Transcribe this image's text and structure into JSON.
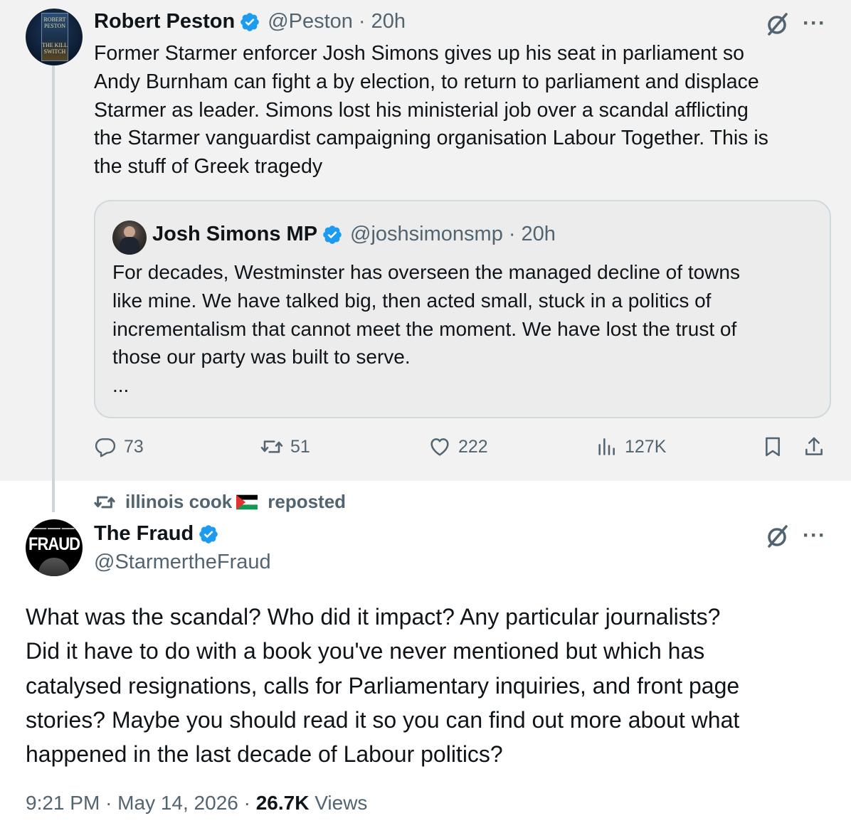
{
  "parent_tweet": {
    "author_name": "Robert Peston",
    "handle": "@Peston",
    "separator": "·",
    "time": "20h",
    "avatar_book_lines": [
      "ROBERT",
      "PESTON",
      "THE KILL",
      "SWITCH"
    ],
    "text_lines": [
      "Former Starmer enforcer Josh Simons gives up his seat in parliament so",
      "Andy Burnham can fight a by election, to return to parliament and displace",
      "Starmer as leader.  Simons lost his ministerial job over a scandal afflicting",
      "the Starmer vanguardist campaigning organisation Labour Together.  This is",
      "the stuff of Greek tragedy"
    ],
    "quote": {
      "author_name": "Josh Simons MP",
      "handle": "@joshsimonsmp",
      "separator": "·",
      "time": "20h",
      "text_lines": [
        "For decades, Westminster has overseen the managed decline of towns",
        "like mine. We have talked big, then acted small, stuck in a politics of",
        "incrementalism that cannot meet the moment. We have lost the trust of",
        "those our party was built to serve.",
        "..."
      ]
    },
    "actions": {
      "replies": "73",
      "reposts": "51",
      "likes": "222",
      "views": "127K"
    }
  },
  "repost_banner": {
    "user": "illinois cook",
    "suffix": "reposted"
  },
  "main_tweet": {
    "author_name": "The Fraud",
    "handle": "@StarmertheFraud",
    "avatar_label": "FRAUD",
    "text_lines": [
      "What was the scandal? Who did it impact? Any particular journalists?",
      "Did it have to do with a book you've never mentioned but which has",
      "catalysed resignations, calls for Parliamentary inquiries, and front page",
      "stories? Maybe you should read it so you can find out more about what",
      "happened in the last decade of Labour politics?"
    ],
    "time": "9:21 PM",
    "date": "May 14, 2026",
    "separator": "·",
    "views_count": "26.7K",
    "views_label": "Views"
  },
  "icons": {
    "verified": "verified-badge-icon",
    "grok": "grok-icon",
    "more": "more-icon",
    "reply": "reply-icon",
    "repost": "repost-icon",
    "like": "heart-icon",
    "views": "views-icon",
    "bookmark": "bookmark-icon",
    "share": "share-icon",
    "flag": "palestine-flag-icon"
  },
  "colors": {
    "verified_blue": "#1d9bf0",
    "text_primary": "#0f1419",
    "text_secondary": "#536471",
    "parent_background": "#f2f2f2",
    "border": "#cfd9de"
  }
}
